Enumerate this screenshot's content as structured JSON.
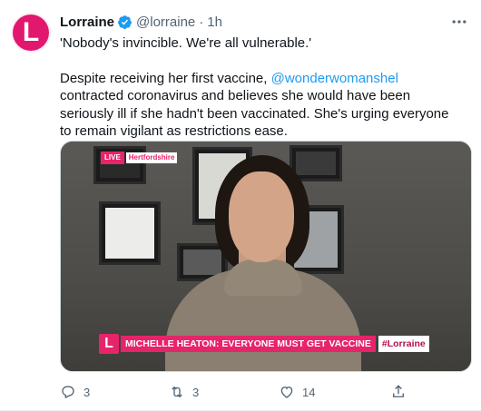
{
  "tweet": {
    "author": {
      "display_name": "Lorraine",
      "handle": "@lorraine",
      "avatar_letter": "L",
      "verified_icon": "verified-badge-icon"
    },
    "separator": "·",
    "time": "1h",
    "paragraph_1": "'Nobody's invincible. We're all vulnerable.'",
    "paragraph_2_before": "Despite receiving her first vaccine, ",
    "mention": "@wonderwomanshel",
    "paragraph_2_after": " contracted coronavirus and believes she would have been seriously ill if she hadn't been vaccinated. She's urging everyone to remain vigilant as restrictions ease.",
    "media": {
      "live_label": "LIVE",
      "location": "Hertfordshire",
      "strap_logo": "L",
      "strap_text": "MICHELLE HEATON: EVERYONE MUST GET VACCINE",
      "strap_hashtag": "#Lorraine"
    },
    "actions": {
      "reply_count": "3",
      "retweet_count": "3",
      "like_count": "14"
    }
  },
  "colors": {
    "brand_pink": "#e6246a",
    "link_blue": "#1d9bf0",
    "muted_text": "#536471"
  }
}
